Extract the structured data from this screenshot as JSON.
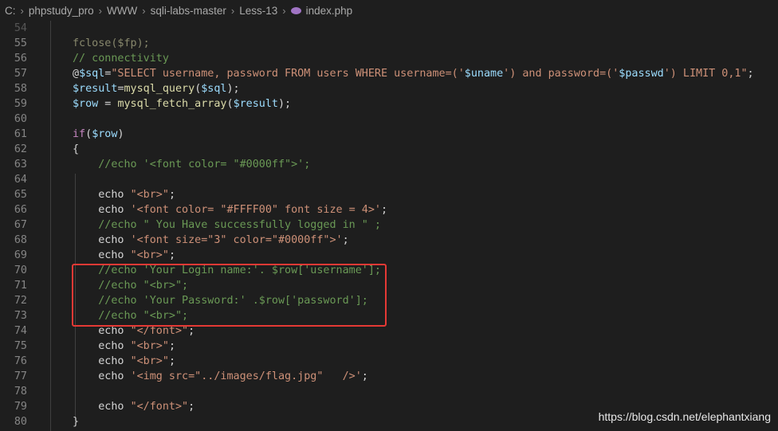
{
  "breadcrumb": {
    "items": [
      "C:",
      "phpstudy_pro",
      "WWW",
      "sqli-labs-master",
      "Less-13"
    ],
    "file": "index.php",
    "file_icon": "php-elephant-icon"
  },
  "lines": [
    {
      "n": "55",
      "tokens": []
    },
    {
      "n": "56",
      "tokens": [
        [
          "comment",
          "// connectivity"
        ]
      ]
    },
    {
      "n": "57",
      "tokens": [
        [
          "plain",
          "@"
        ],
        [
          "var",
          "$sql"
        ],
        [
          "plain",
          "="
        ],
        [
          "string",
          "\"SELECT username, password FROM users WHERE username=('"
        ],
        [
          "var",
          "$uname"
        ],
        [
          "string",
          "') and password=('"
        ],
        [
          "var",
          "$passwd"
        ],
        [
          "string",
          "') LIMIT 0,1\""
        ],
        [
          "plain",
          ";"
        ]
      ]
    },
    {
      "n": "58",
      "tokens": [
        [
          "var",
          "$result"
        ],
        [
          "plain",
          "="
        ],
        [
          "func",
          "mysql_query"
        ],
        [
          "plain",
          "("
        ],
        [
          "var",
          "$sql"
        ],
        [
          "plain",
          ");"
        ]
      ]
    },
    {
      "n": "59",
      "tokens": [
        [
          "var",
          "$row"
        ],
        [
          "plain",
          " = "
        ],
        [
          "func",
          "mysql_fetch_array"
        ],
        [
          "plain",
          "("
        ],
        [
          "var",
          "$result"
        ],
        [
          "plain",
          ");"
        ]
      ]
    },
    {
      "n": "60",
      "tokens": []
    },
    {
      "n": "61",
      "tokens": [
        [
          "key",
          "if"
        ],
        [
          "plain",
          "("
        ],
        [
          "var",
          "$row"
        ],
        [
          "plain",
          ")"
        ]
      ]
    },
    {
      "n": "62",
      "tokens": [
        [
          "plain",
          "{"
        ]
      ]
    },
    {
      "n": "63",
      "tokens": [
        [
          "plain",
          "    "
        ],
        [
          "comment",
          "//echo '<font color= \"#0000ff\">';"
        ]
      ]
    },
    {
      "n": "64",
      "tokens": []
    },
    {
      "n": "65",
      "tokens": [
        [
          "plain",
          "    echo "
        ],
        [
          "string",
          "\"<br>\""
        ],
        [
          "plain",
          ";"
        ]
      ]
    },
    {
      "n": "66",
      "tokens": [
        [
          "plain",
          "    echo "
        ],
        [
          "string",
          "'<font color= \"#FFFF00\" font size = 4>'"
        ],
        [
          "plain",
          ";"
        ]
      ]
    },
    {
      "n": "67",
      "tokens": [
        [
          "plain",
          "    "
        ],
        [
          "comment",
          "//echo \" You Have successfully logged in \" ;"
        ]
      ]
    },
    {
      "n": "68",
      "tokens": [
        [
          "plain",
          "    echo "
        ],
        [
          "string",
          "'<font size=\"3\" color=\"#0000ff\">'"
        ],
        [
          "plain",
          ";"
        ]
      ]
    },
    {
      "n": "69",
      "tokens": [
        [
          "plain",
          "    echo "
        ],
        [
          "string",
          "\"<br>\""
        ],
        [
          "plain",
          ";"
        ]
      ]
    },
    {
      "n": "70",
      "tokens": [
        [
          "plain",
          "    "
        ],
        [
          "comment",
          "//echo 'Your Login name:'. $row['username'];"
        ]
      ]
    },
    {
      "n": "71",
      "tokens": [
        [
          "plain",
          "    "
        ],
        [
          "comment",
          "//echo \"<br>\";"
        ]
      ]
    },
    {
      "n": "72",
      "tokens": [
        [
          "plain",
          "    "
        ],
        [
          "comment",
          "//echo 'Your Password:' .$row['password'];"
        ]
      ]
    },
    {
      "n": "73",
      "tokens": [
        [
          "plain",
          "    "
        ],
        [
          "comment",
          "//echo \"<br>\";"
        ]
      ]
    },
    {
      "n": "74",
      "tokens": [
        [
          "plain",
          "    echo "
        ],
        [
          "string",
          "\"</font>\""
        ],
        [
          "plain",
          ";"
        ]
      ]
    },
    {
      "n": "75",
      "tokens": [
        [
          "plain",
          "    echo "
        ],
        [
          "string",
          "\"<br>\""
        ],
        [
          "plain",
          ";"
        ]
      ]
    },
    {
      "n": "76",
      "tokens": [
        [
          "plain",
          "    echo "
        ],
        [
          "string",
          "\"<br>\""
        ],
        [
          "plain",
          ";"
        ]
      ]
    },
    {
      "n": "77",
      "tokens": [
        [
          "plain",
          "    echo "
        ],
        [
          "string",
          "'<img src=\"../images/flag.jpg\"   />'"
        ],
        [
          "plain",
          ";"
        ]
      ]
    },
    {
      "n": "78",
      "tokens": []
    },
    {
      "n": "79",
      "tokens": [
        [
          "plain",
          "    echo "
        ],
        [
          "string",
          "\"</font>\""
        ],
        [
          "plain",
          ";"
        ]
      ]
    },
    {
      "n": "80",
      "tokens": [
        [
          "plain",
          "}"
        ]
      ]
    }
  ],
  "partial_lines": {
    "top_number": "54",
    "top_text": "fclose($fp);"
  },
  "watermark": "https://blog.csdn.net/elephantxiang",
  "colors": {
    "background": "#1e1e1e",
    "comment": "#6a9955",
    "string": "#ce9178",
    "variable": "#9cdcfe",
    "highlight_box": "#e53935"
  }
}
